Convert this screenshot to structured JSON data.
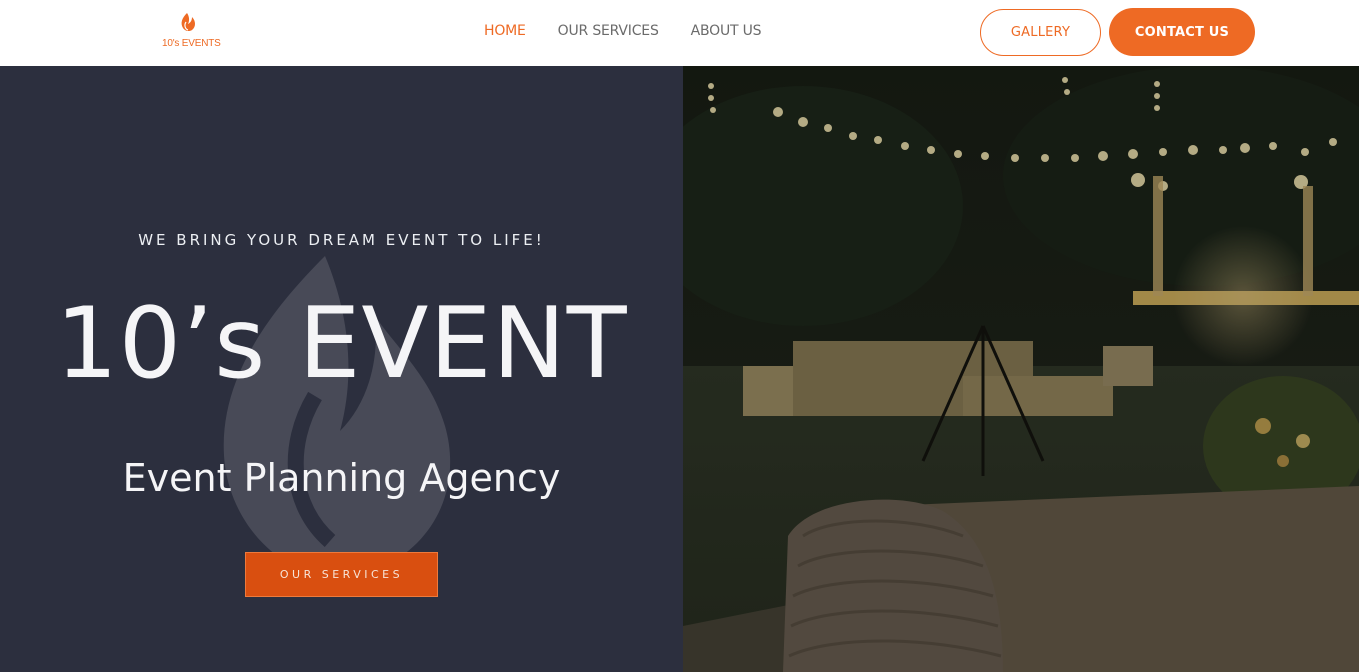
{
  "header": {
    "logo_text": "10's EVENTS",
    "nav": [
      {
        "label": "HOME",
        "active": true
      },
      {
        "label": "OUR SERVICES",
        "active": false
      },
      {
        "label": "ABOUT US",
        "active": false
      }
    ],
    "gallery_label": "GALLERY",
    "contact_label": "CONTACT US"
  },
  "hero": {
    "tagline": "WE BRING YOUR DREAM EVENT TO LIFE!",
    "title": "10’s EVENT",
    "subtitle": "Event Planning Agency",
    "cta_label": "OUR SERVICES"
  },
  "colors": {
    "accent": "#ee6a24",
    "hero_bg": "#2c2f3e",
    "cta_bg": "#d94f10"
  },
  "icons": {
    "logo": "flame-logo-icon",
    "watermark": "flame-watermark-icon"
  }
}
